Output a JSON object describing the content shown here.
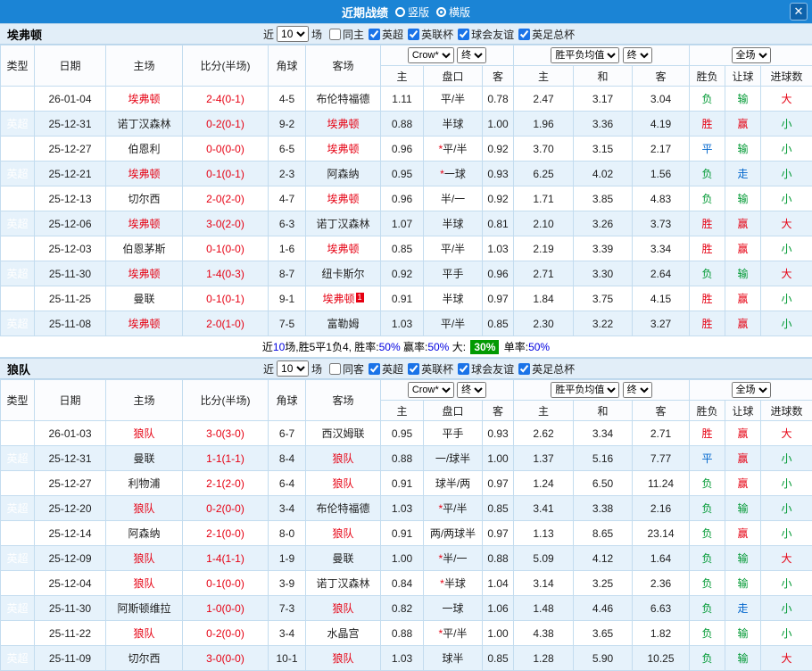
{
  "colors": {
    "titlebar_blue": "#1b84d5",
    "league_red": "#e60012",
    "win_red": "#e60012",
    "lose_green": "#009933",
    "draw_blue": "#0066cc",
    "alt_row_blue": "#e6f2fb",
    "summary_badge_green": "#029a02"
  },
  "titlebar": {
    "title": "近期战绩",
    "radio_options": [
      {
        "label": "竖版",
        "selected": false
      },
      {
        "label": "横版",
        "selected": true
      }
    ],
    "close_label": "✕"
  },
  "sections": [
    {
      "team": "埃弗顿",
      "filter": {
        "near": "近",
        "count": "10",
        "games": "场",
        "checkboxes": [
          {
            "label": "同主",
            "checked": false
          },
          {
            "label": "英超",
            "checked": true
          },
          {
            "label": "英联杯",
            "checked": true
          },
          {
            "label": "球会友谊",
            "checked": true
          },
          {
            "label": "英足总杯",
            "checked": true
          }
        ]
      },
      "header": {
        "type": "类型",
        "date": "日期",
        "home": "主场",
        "score": "比分(半场)",
        "corner": "角球",
        "away": "客场",
        "bookmaker": "Crow*",
        "final1": "终",
        "asia_home": "主",
        "asia_handicap": "盘口",
        "asia_away": "客",
        "europe": "胜平负均值",
        "final2": "终",
        "eu_home": "主",
        "eu_draw": "和",
        "eu_away": "客",
        "scope": "全场",
        "wl": "胜负",
        "rang": "让球",
        "goals": "进球数"
      },
      "rows": [
        {
          "league": "英超",
          "date": "26-01-04",
          "home": "埃弗顿",
          "home_hl": true,
          "score": "2-4(0-1)",
          "corner": "4-5",
          "away": "布伦特福德",
          "away_hl": false,
          "asia": [
            "1.11",
            "平/半",
            "0.78"
          ],
          "europe": [
            "2.47",
            "3.17",
            "3.04"
          ],
          "wl": "负",
          "rang": "输",
          "goal": "大"
        },
        {
          "league": "英超",
          "date": "25-12-31",
          "home": "诺丁汉森林",
          "home_hl": false,
          "score": "0-2(0-1)",
          "corner": "9-2",
          "away": "埃弗顿",
          "away_hl": true,
          "asia": [
            "0.88",
            "半球",
            "1.00"
          ],
          "europe": [
            "1.96",
            "3.36",
            "4.19"
          ],
          "wl": "胜",
          "rang": "赢",
          "goal": "小"
        },
        {
          "league": "英超",
          "date": "25-12-27",
          "home": "伯恩利",
          "home_hl": false,
          "score": "0-0(0-0)",
          "corner": "6-5",
          "away": "埃弗顿",
          "away_hl": true,
          "asia": [
            "0.96",
            "*平/半",
            "0.92"
          ],
          "europe": [
            "3.70",
            "3.15",
            "2.17"
          ],
          "wl": "平",
          "rang": "输",
          "goal": "小"
        },
        {
          "league": "英超",
          "date": "25-12-21",
          "home": "埃弗顿",
          "home_hl": true,
          "score": "0-1(0-1)",
          "corner": "2-3",
          "away": "阿森纳",
          "away_hl": false,
          "asia": [
            "0.95",
            "*一球",
            "0.93"
          ],
          "europe": [
            "6.25",
            "4.02",
            "1.56"
          ],
          "wl": "负",
          "rang": "走",
          "goal": "小"
        },
        {
          "league": "英超",
          "date": "25-12-13",
          "home": "切尔西",
          "home_hl": false,
          "score": "2-0(2-0)",
          "corner": "4-7",
          "away": "埃弗顿",
          "away_hl": true,
          "asia": [
            "0.96",
            "半/一",
            "0.92"
          ],
          "europe": [
            "1.71",
            "3.85",
            "4.83"
          ],
          "wl": "负",
          "rang": "输",
          "goal": "小"
        },
        {
          "league": "英超",
          "date": "25-12-06",
          "home": "埃弗顿",
          "home_hl": true,
          "score": "3-0(2-0)",
          "corner": "6-3",
          "away": "诺丁汉森林",
          "away_hl": false,
          "asia": [
            "1.07",
            "半球",
            "0.81"
          ],
          "europe": [
            "2.10",
            "3.26",
            "3.73"
          ],
          "wl": "胜",
          "rang": "赢",
          "goal": "大"
        },
        {
          "league": "英超",
          "date": "25-12-03",
          "home": "伯恩茅斯",
          "home_hl": false,
          "score": "0-1(0-0)",
          "corner": "1-6",
          "away": "埃弗顿",
          "away_hl": true,
          "asia": [
            "0.85",
            "平/半",
            "1.03"
          ],
          "europe": [
            "2.19",
            "3.39",
            "3.34"
          ],
          "wl": "胜",
          "rang": "赢",
          "goal": "小"
        },
        {
          "league": "英超",
          "date": "25-11-30",
          "home": "埃弗顿",
          "home_hl": true,
          "score": "1-4(0-3)",
          "corner": "8-7",
          "away": "纽卡斯尔",
          "away_hl": false,
          "asia": [
            "0.92",
            "平手",
            "0.96"
          ],
          "europe": [
            "2.71",
            "3.30",
            "2.64"
          ],
          "wl": "负",
          "rang": "输",
          "goal": "大"
        },
        {
          "league": "英超",
          "date": "25-11-25",
          "home": "曼联",
          "home_hl": false,
          "score": "0-1(0-1)",
          "corner": "9-1",
          "away": "埃弗顿",
          "away_hl": true,
          "away_sup": "1",
          "asia": [
            "0.91",
            "半球",
            "0.97"
          ],
          "europe": [
            "1.84",
            "3.75",
            "4.15"
          ],
          "wl": "胜",
          "rang": "赢",
          "goal": "小"
        },
        {
          "league": "英超",
          "date": "25-11-08",
          "home": "埃弗顿",
          "home_hl": true,
          "score": "2-0(1-0)",
          "corner": "7-5",
          "away": "富勒姆",
          "away_hl": false,
          "asia": [
            "1.03",
            "平/半",
            "0.85"
          ],
          "europe": [
            "2.30",
            "3.22",
            "3.27"
          ],
          "wl": "胜",
          "rang": "赢",
          "goal": "小"
        }
      ],
      "summary": [
        {
          "text": "近"
        },
        {
          "text": "10",
          "class": "blue"
        },
        {
          "text": "场,胜5平1负4, 胜率:"
        },
        {
          "text": "50%",
          "class": "blue"
        },
        {
          "text": " 赢率:"
        },
        {
          "text": "50%",
          "class": "blue"
        },
        {
          "text": " 大: "
        },
        {
          "text": "30%",
          "class": "badge"
        },
        {
          "text": " 单率:"
        },
        {
          "text": "50%",
          "class": "blue"
        }
      ]
    },
    {
      "team": "狼队",
      "filter": {
        "near": "近",
        "count": "10",
        "games": "场",
        "checkboxes": [
          {
            "label": "同客",
            "checked": false
          },
          {
            "label": "英超",
            "checked": true
          },
          {
            "label": "英联杯",
            "checked": true
          },
          {
            "label": "球会友谊",
            "checked": true
          },
          {
            "label": "英足总杯",
            "checked": true
          }
        ]
      },
      "header": {
        "type": "类型",
        "date": "日期",
        "home": "主场",
        "score": "比分(半场)",
        "corner": "角球",
        "away": "客场",
        "bookmaker": "Crow*",
        "final1": "终",
        "asia_home": "主",
        "asia_handicap": "盘口",
        "asia_away": "客",
        "europe": "胜平负均值",
        "final2": "终",
        "eu_home": "主",
        "eu_draw": "和",
        "eu_away": "客",
        "scope": "全场",
        "wl": "胜负",
        "rang": "让球",
        "goals": "进球数"
      },
      "rows": [
        {
          "league": "英超",
          "date": "26-01-03",
          "home": "狼队",
          "home_hl": true,
          "score": "3-0(3-0)",
          "corner": "6-7",
          "away": "西汉姆联",
          "away_hl": false,
          "asia": [
            "0.95",
            "平手",
            "0.93"
          ],
          "europe": [
            "2.62",
            "3.34",
            "2.71"
          ],
          "wl": "胜",
          "rang": "赢",
          "goal": "大"
        },
        {
          "league": "英超",
          "date": "25-12-31",
          "home": "曼联",
          "home_hl": false,
          "score": "1-1(1-1)",
          "corner": "8-4",
          "away": "狼队",
          "away_hl": true,
          "asia": [
            "0.88",
            "一/球半",
            "1.00"
          ],
          "europe": [
            "1.37",
            "5.16",
            "7.77"
          ],
          "wl": "平",
          "rang": "赢",
          "goal": "小"
        },
        {
          "league": "英超",
          "date": "25-12-27",
          "home": "利物浦",
          "home_hl": false,
          "score": "2-1(2-0)",
          "corner": "6-4",
          "away": "狼队",
          "away_hl": true,
          "asia": [
            "0.91",
            "球半/两",
            "0.97"
          ],
          "europe": [
            "1.24",
            "6.50",
            "11.24"
          ],
          "wl": "负",
          "rang": "赢",
          "goal": "小"
        },
        {
          "league": "英超",
          "date": "25-12-20",
          "home": "狼队",
          "home_hl": true,
          "score": "0-2(0-0)",
          "corner": "3-4",
          "away": "布伦特福德",
          "away_hl": false,
          "asia": [
            "1.03",
            "*平/半",
            "0.85"
          ],
          "europe": [
            "3.41",
            "3.38",
            "2.16"
          ],
          "wl": "负",
          "rang": "输",
          "goal": "小"
        },
        {
          "league": "英超",
          "date": "25-12-14",
          "home": "阿森纳",
          "home_hl": false,
          "score": "2-1(0-0)",
          "corner": "8-0",
          "away": "狼队",
          "away_hl": true,
          "asia": [
            "0.91",
            "两/两球半",
            "0.97"
          ],
          "europe": [
            "1.13",
            "8.65",
            "23.14"
          ],
          "wl": "负",
          "rang": "赢",
          "goal": "小"
        },
        {
          "league": "英超",
          "date": "25-12-09",
          "home": "狼队",
          "home_hl": true,
          "score": "1-4(1-1)",
          "corner": "1-9",
          "away": "曼联",
          "away_hl": false,
          "asia": [
            "1.00",
            "*半/一",
            "0.88"
          ],
          "europe": [
            "5.09",
            "4.12",
            "1.64"
          ],
          "wl": "负",
          "rang": "输",
          "goal": "大"
        },
        {
          "league": "英超",
          "date": "25-12-04",
          "home": "狼队",
          "home_hl": true,
          "score": "0-1(0-0)",
          "corner": "3-9",
          "away": "诺丁汉森林",
          "away_hl": false,
          "asia": [
            "0.84",
            "*半球",
            "1.04"
          ],
          "europe": [
            "3.14",
            "3.25",
            "2.36"
          ],
          "wl": "负",
          "rang": "输",
          "goal": "小"
        },
        {
          "league": "英超",
          "date": "25-11-30",
          "home": "阿斯顿维拉",
          "home_hl": false,
          "score": "1-0(0-0)",
          "corner": "7-3",
          "away": "狼队",
          "away_hl": true,
          "asia": [
            "0.82",
            "一球",
            "1.06"
          ],
          "europe": [
            "1.48",
            "4.46",
            "6.63"
          ],
          "wl": "负",
          "rang": "走",
          "goal": "小"
        },
        {
          "league": "英超",
          "date": "25-11-22",
          "home": "狼队",
          "home_hl": true,
          "score": "0-2(0-0)",
          "corner": "3-4",
          "away": "水晶宫",
          "away_hl": false,
          "asia": [
            "0.88",
            "*平/半",
            "1.00"
          ],
          "europe": [
            "4.38",
            "3.65",
            "1.82"
          ],
          "wl": "负",
          "rang": "输",
          "goal": "小"
        },
        {
          "league": "英超",
          "date": "25-11-09",
          "home": "切尔西",
          "home_hl": false,
          "score": "3-0(0-0)",
          "corner": "10-1",
          "away": "狼队",
          "away_hl": true,
          "asia": [
            "1.03",
            "球半",
            "0.85"
          ],
          "europe": [
            "1.28",
            "5.90",
            "10.25"
          ],
          "wl": "负",
          "rang": "输",
          "goal": "大"
        }
      ],
      "summary": []
    }
  ]
}
